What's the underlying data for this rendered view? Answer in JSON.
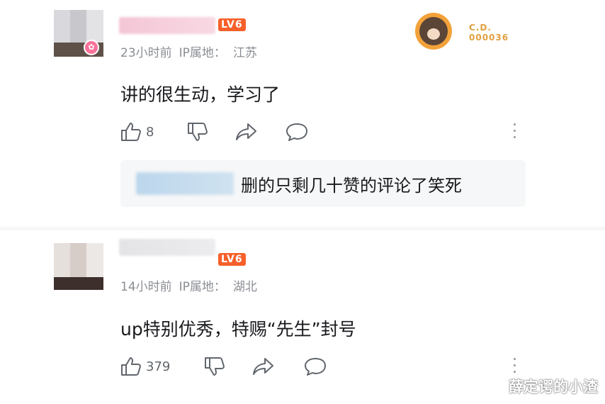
{
  "comments": [
    {
      "meta": {
        "time": "23小时前",
        "ip_label": "IP属地：",
        "location": "江苏"
      },
      "level": "LV6",
      "text": "讲的很生动，学习了",
      "likes": "8",
      "fan_badge": {
        "label": "C.D.",
        "number": "000036"
      },
      "reply": {
        "text": "删的只剩几十赞的评论了笑死"
      }
    },
    {
      "meta": {
        "time": "14小时前",
        "ip_label": "IP属地：",
        "location": "湖北"
      },
      "level": "LV6",
      "text": "up特别优秀，特赐“先生”封号",
      "likes": "379"
    }
  ],
  "watermark": "薛定谔的小渣",
  "colors": {
    "accent_pink": "#fb7299",
    "level_orange": "#f6602a",
    "meta_gray": "#8a8d93"
  }
}
